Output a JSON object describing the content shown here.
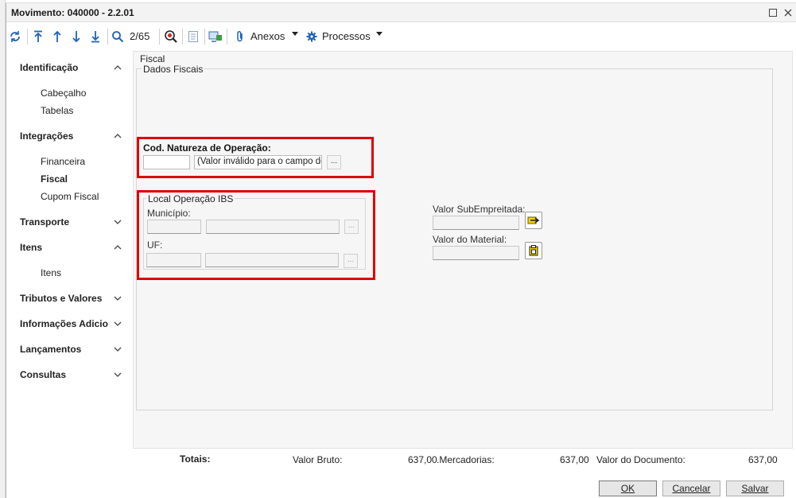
{
  "window": {
    "title": "Movimento: 040000 - 2.2.01"
  },
  "toolbar": {
    "counter": "2/65",
    "anexos_label": "Anexos",
    "processos_label": "Processos"
  },
  "sidebar": {
    "groups": [
      {
        "label": "Identificação",
        "items": [
          "Cabeçalho",
          "Tabelas"
        ]
      },
      {
        "label": "Integrações",
        "items": [
          "Financeira",
          "Fiscal",
          "Cupom Fiscal"
        ]
      },
      {
        "label": "Transporte"
      },
      {
        "label": "Itens",
        "items": [
          "Itens"
        ]
      },
      {
        "label": "Tributos e Valores"
      },
      {
        "label": "Informações Adicio"
      },
      {
        "label": "Lançamentos"
      },
      {
        "label": "Consultas"
      }
    ],
    "active_item": "Fiscal"
  },
  "content": {
    "section_title": "Fiscal",
    "fieldset_title": "Dados Fiscais",
    "natureza": {
      "label": "Cod. Natureza de Operação:",
      "code_value": "",
      "description_value": "(Valor inválido para o campo de lo",
      "lookup_label": "..."
    },
    "local_ibs": {
      "legend": "Local Operação IBS",
      "municipio_label": "Município:",
      "uf_label": "UF:",
      "lookup_label": "..."
    },
    "valor_subempreitada_label": "Valor SubEmpreitada:",
    "valor_material_label": "Valor do Material:"
  },
  "totals": {
    "label": "Totais:",
    "valor_bruto_label": "Valor Bruto:",
    "valor_bruto_value": "637,00",
    "mercadorias_label": ".Mercadorias:",
    "mercadorias_value": "637,00",
    "valor_documento_label": "Valor do Documento:",
    "valor_documento_value": "637,00"
  },
  "buttons": {
    "ok": "OK",
    "cancelar": "Cancelar",
    "salvar": "Salvar"
  },
  "colors": {
    "highlight_box": "#e00000",
    "toolbar_icon": "#1f63b8"
  }
}
